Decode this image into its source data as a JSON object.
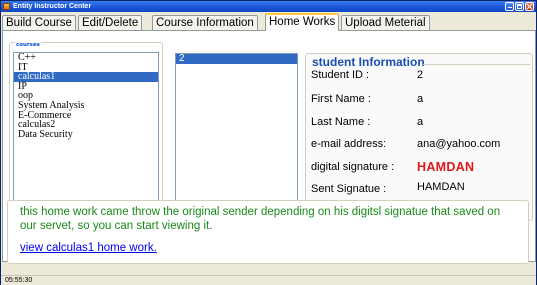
{
  "window": {
    "title": "Entity Instructor Center"
  },
  "tabs": [
    {
      "label": "Build Course"
    },
    {
      "label": "Edit/Delete"
    },
    {
      "label": "Course Information"
    },
    {
      "label": "Home Works",
      "active": true
    },
    {
      "label": "Upload Meterial"
    }
  ],
  "courses": {
    "legend": "courses",
    "items": [
      "C++",
      "IT",
      "calculas1",
      "IP",
      "oop",
      "System Analysis",
      "E-Commerce",
      "calculas2",
      "Data Security"
    ],
    "selected": "calculas1"
  },
  "student_ids": {
    "items": [
      "2"
    ],
    "selected": "2"
  },
  "student_info": {
    "title": "student Information",
    "fields": [
      {
        "label": "Student ID :",
        "value": "2"
      },
      {
        "label": "First Name :",
        "value": "a"
      },
      {
        "label": "Last Name :",
        "value": "a"
      },
      {
        "label": "e-mail address:",
        "value": "ana@yahoo.com"
      },
      {
        "label": "digital signature :",
        "value": "HAMDAN"
      },
      {
        "label": "Sent Signatue :",
        "value": "HAMDAN"
      }
    ]
  },
  "message": {
    "text": "this home work came throw the original sender depending on his digitsl signatue that saved on our servet, so you can start viewing it.",
    "link": "view calculas1 home work."
  },
  "status": {
    "time": "05:55:30"
  },
  "colors": {
    "title_bar": "#1F5BD8",
    "selection": "#316AC5",
    "message_text": "#1A8A1A",
    "signature": "#E0181C",
    "link": "#0000EE",
    "info_title": "#1A4FB0"
  }
}
